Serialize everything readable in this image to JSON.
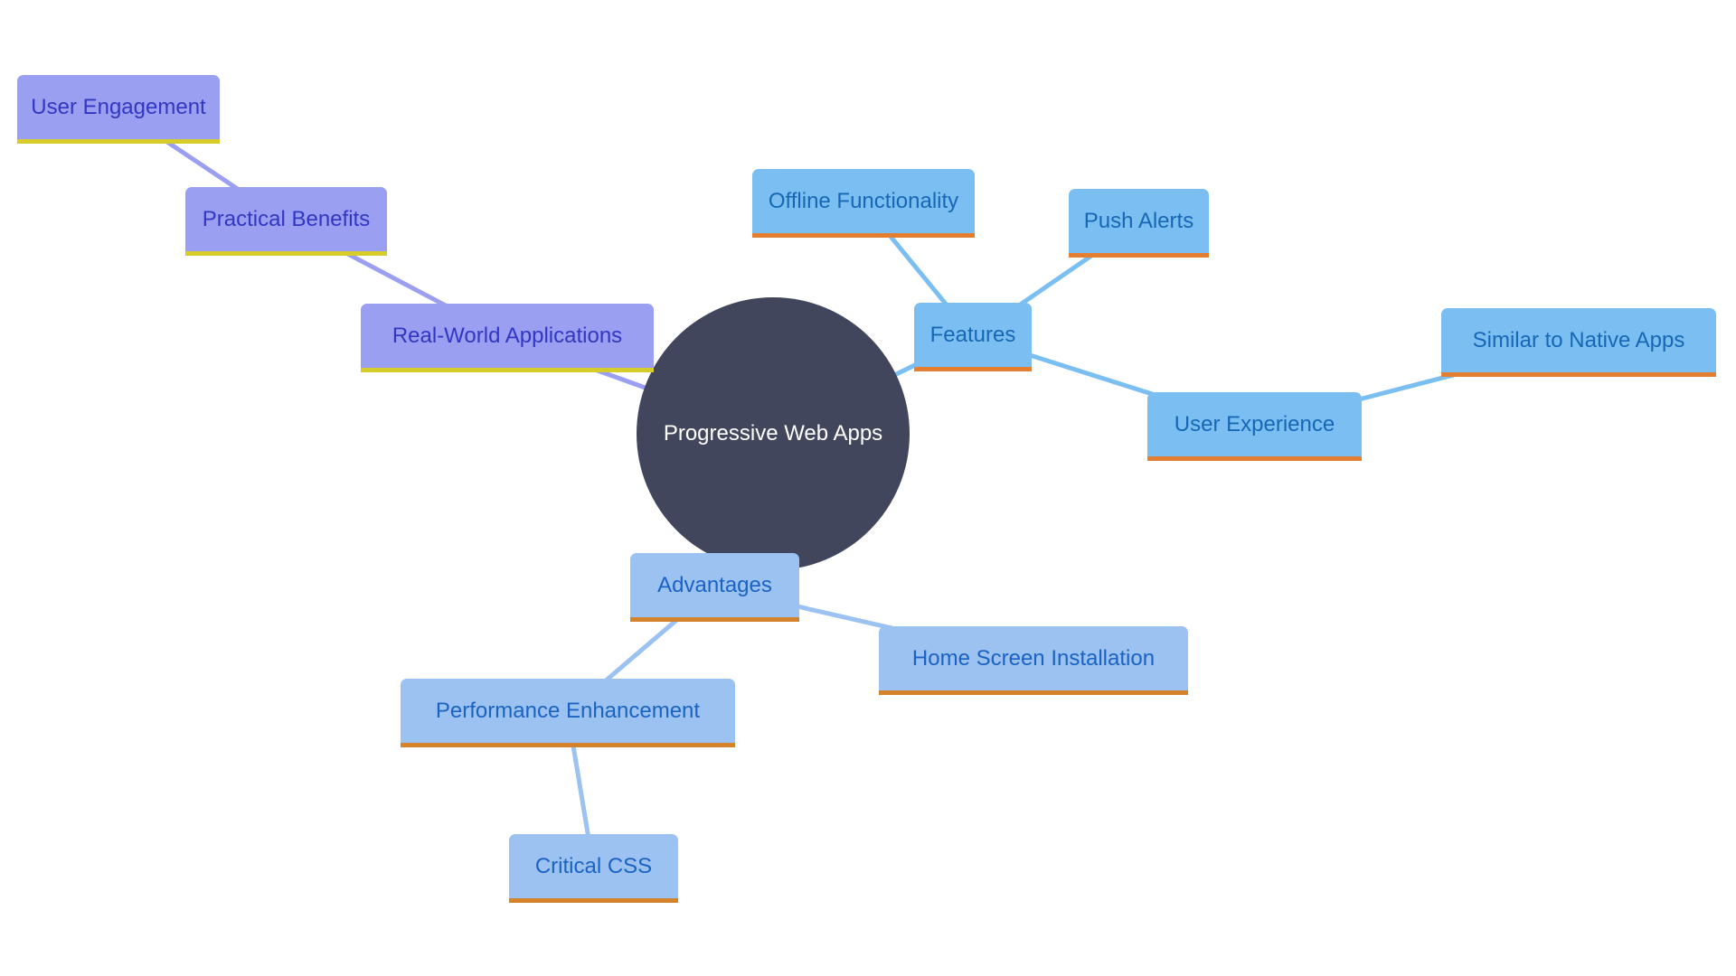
{
  "diagram": {
    "type": "mindmap",
    "root": {
      "id": "root",
      "label": "Progressive Web Apps",
      "color": "#42465d",
      "text_color": "#ffffff"
    },
    "branch_colors": {
      "purple": {
        "fill": "#9a9ff2",
        "text": "#3237c2",
        "underline": "#d6cd2b",
        "edge": "#9a9ff2"
      },
      "sky": {
        "fill": "#7bbff2",
        "text": "#1767b5",
        "underline": "#e47e31",
        "edge": "#7bbff2"
      },
      "blue": {
        "fill": "#9bc2f0",
        "text": "#1b63c2",
        "underline": "#d5832b",
        "edge": "#9bc2f0"
      }
    },
    "nodes": [
      {
        "id": "rwa",
        "label": "Real-World Applications",
        "parent": "root",
        "branch": "purple"
      },
      {
        "id": "pb",
        "label": "Practical Benefits",
        "parent": "rwa",
        "branch": "purple"
      },
      {
        "id": "ue",
        "label": "User Engagement",
        "parent": "pb",
        "branch": "purple"
      },
      {
        "id": "feat",
        "label": "Features",
        "parent": "root",
        "branch": "sky"
      },
      {
        "id": "off",
        "label": "Offline Functionality",
        "parent": "feat",
        "branch": "sky"
      },
      {
        "id": "push",
        "label": "Push Alerts",
        "parent": "feat",
        "branch": "sky"
      },
      {
        "id": "ux",
        "label": "User Experience",
        "parent": "feat",
        "branch": "sky"
      },
      {
        "id": "native",
        "label": "Similar to Native Apps",
        "parent": "ux",
        "branch": "sky"
      },
      {
        "id": "adv",
        "label": "Advantages",
        "parent": "root",
        "branch": "blue"
      },
      {
        "id": "home",
        "label": "Home Screen Installation",
        "parent": "adv",
        "branch": "blue"
      },
      {
        "id": "perf",
        "label": "Performance Enhancement",
        "parent": "adv",
        "branch": "blue"
      },
      {
        "id": "css",
        "label": "Critical CSS",
        "parent": "perf",
        "branch": "blue"
      }
    ]
  }
}
